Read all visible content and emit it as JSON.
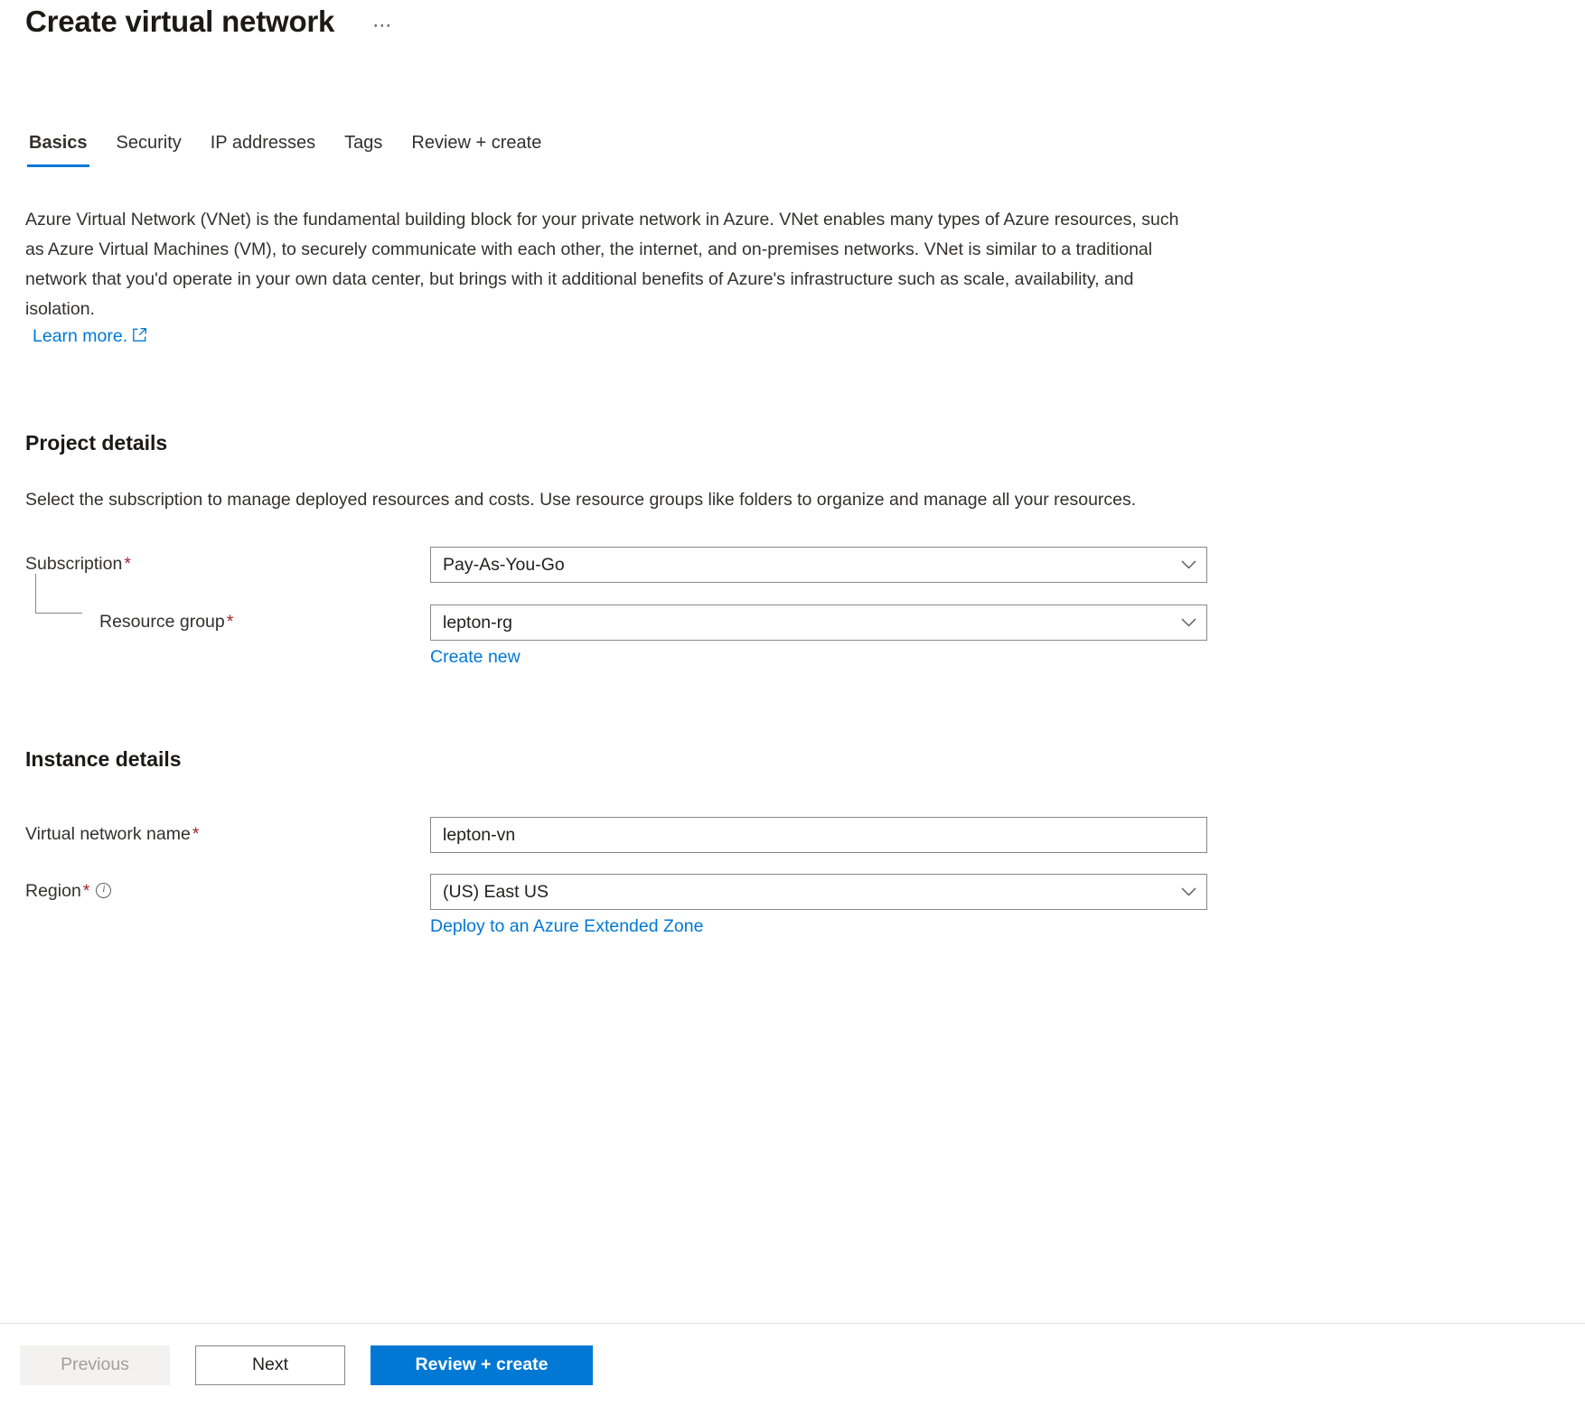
{
  "header": {
    "title": "Create virtual network",
    "more_label": "⋯"
  },
  "tabs": [
    {
      "label": "Basics",
      "active": true
    },
    {
      "label": "Security",
      "active": false
    },
    {
      "label": "IP addresses",
      "active": false
    },
    {
      "label": "Tags",
      "active": false
    },
    {
      "label": "Review + create",
      "active": false
    }
  ],
  "intro": {
    "text": "Azure Virtual Network (VNet) is the fundamental building block for your private network in Azure. VNet enables many types of Azure resources, such as Azure Virtual Machines (VM), to securely communicate with each other, the internet, and on-premises networks. VNet is similar to a traditional network that you'd operate in your own data center, but brings with it additional benefits of Azure's infrastructure such as scale, availability, and isolation.",
    "learn_more": "Learn more."
  },
  "project_details": {
    "title": "Project details",
    "description": "Select the subscription to manage deployed resources and costs. Use resource groups like folders to organize and manage all your resources.",
    "subscription": {
      "label": "Subscription",
      "required": "*",
      "value": "Pay-As-You-Go"
    },
    "resource_group": {
      "label": "Resource group",
      "required": "*",
      "value": "lepton-rg",
      "create_new": "Create new"
    }
  },
  "instance_details": {
    "title": "Instance details",
    "vnet_name": {
      "label": "Virtual network name",
      "required": "*",
      "value": "lepton-vn"
    },
    "region": {
      "label": "Region",
      "required": "*",
      "value": "(US) East US",
      "extended_zone_link": "Deploy to an Azure Extended Zone"
    }
  },
  "footer": {
    "previous": "Previous",
    "next": "Next",
    "review_create": "Review + create"
  },
  "colors": {
    "accent": "#0078d4",
    "link": "#0078d4",
    "required": "#a4262c",
    "border": "#8a8886",
    "text": "#323130"
  }
}
